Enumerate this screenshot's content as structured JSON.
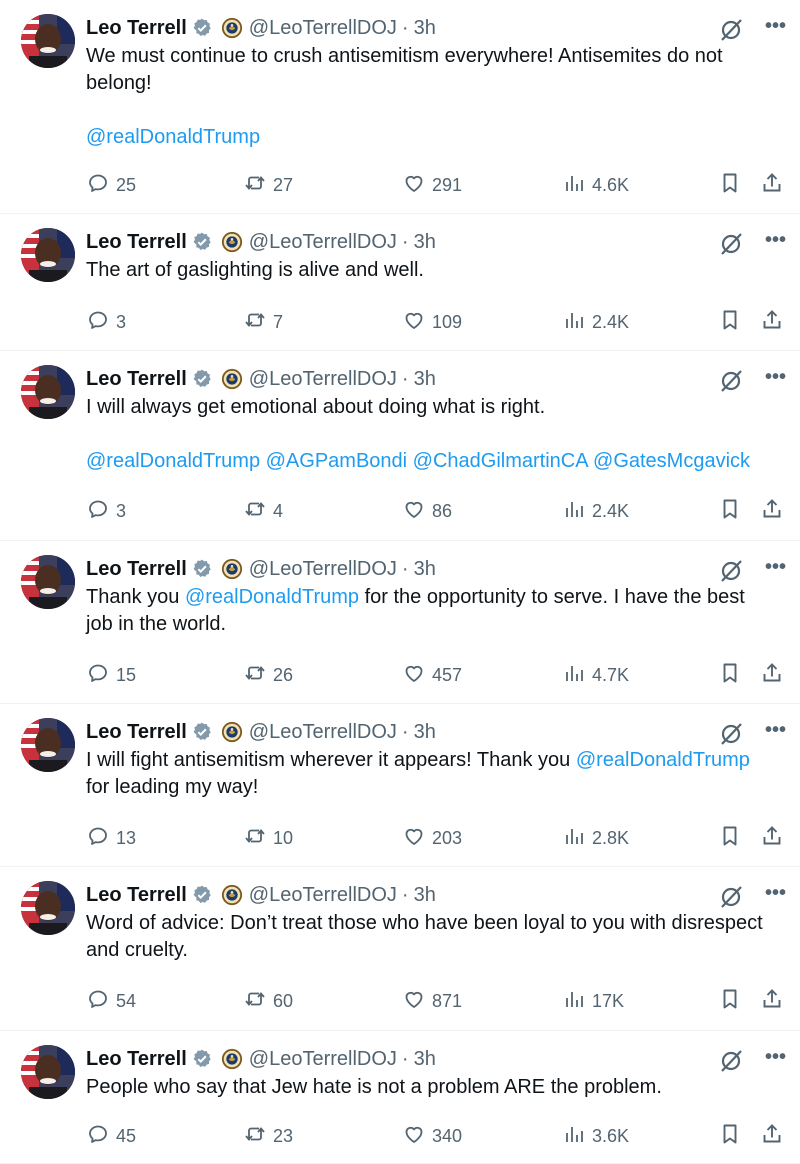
{
  "colors": {
    "link": "#1d9bf0",
    "muted": "#536471",
    "text": "#0f1419",
    "verified": "#829aab"
  },
  "tweets": [
    {
      "author": "Leo Terrell",
      "handle": "@LeoTerrellDOJ",
      "sep": "·",
      "time": "3h",
      "segments": [
        {
          "text": "We must continue to crush antisemitism everywhere! Antisemites do not belong!",
          "mention": false
        }
      ],
      "links": "@realDonaldTrump",
      "replies": "25",
      "reposts": "27",
      "likes": "291",
      "views": "4.6K"
    },
    {
      "author": "Leo Terrell",
      "handle": "@LeoTerrellDOJ",
      "sep": "·",
      "time": "3h",
      "segments": [
        {
          "text": "The art of gaslighting is alive and well.",
          "mention": false
        }
      ],
      "links": "",
      "replies": "3",
      "reposts": "7",
      "likes": "109",
      "views": "2.4K"
    },
    {
      "author": "Leo Terrell",
      "handle": "@LeoTerrellDOJ",
      "sep": "·",
      "time": "3h",
      "segments": [
        {
          "text": "I will always get emotional about doing what is right.",
          "mention": false
        }
      ],
      "links": "@realDonaldTrump @AGPamBondi @ChadGilmartinCA @GatesMcgavick",
      "replies": "3",
      "reposts": "4",
      "likes": "86",
      "views": "2.4K"
    },
    {
      "author": "Leo Terrell",
      "handle": "@LeoTerrellDOJ",
      "sep": "·",
      "time": "3h",
      "segments": [
        {
          "text": "Thank you ",
          "mention": false
        },
        {
          "text": "@realDonaldTrump",
          "mention": true
        },
        {
          "text": " for the opportunity to serve. I have the best job in the world.",
          "mention": false
        }
      ],
      "links": "",
      "replies": "15",
      "reposts": "26",
      "likes": "457",
      "views": "4.7K"
    },
    {
      "author": "Leo Terrell",
      "handle": "@LeoTerrellDOJ",
      "sep": "·",
      "time": "3h",
      "segments": [
        {
          "text": "I will fight antisemitism wherever it appears! Thank you ",
          "mention": false
        },
        {
          "text": "@realDonaldTrump",
          "mention": true
        },
        {
          "text": " for leading my way!",
          "mention": false
        }
      ],
      "links": "",
      "replies": "13",
      "reposts": "10",
      "likes": "203",
      "views": "2.8K"
    },
    {
      "author": "Leo Terrell",
      "handle": "@LeoTerrellDOJ",
      "sep": "·",
      "time": "3h",
      "segments": [
        {
          "text": "Word of advice: Don’t treat those who have been loyal to you with disrespect and cruelty.",
          "mention": false
        }
      ],
      "links": "",
      "replies": "54",
      "reposts": "60",
      "likes": "871",
      "views": "17K"
    },
    {
      "author": "Leo Terrell",
      "handle": "@LeoTerrellDOJ",
      "sep": "·",
      "time": "3h",
      "segments": [
        {
          "text": "People who say that Jew hate is not a problem ARE the problem.",
          "mention": false
        }
      ],
      "links": "",
      "replies": "45",
      "reposts": "23",
      "likes": "340",
      "views": "3.6K"
    }
  ],
  "icons": {
    "verified": "verified-badge-icon",
    "seal": "doj-seal-icon",
    "grok": "grok-icon",
    "more": "more-icon",
    "reply": "reply-icon",
    "repost": "repost-icon",
    "like": "like-icon",
    "views": "views-icon",
    "bookmark": "bookmark-icon",
    "share": "share-icon"
  },
  "more_glyph": "•••"
}
